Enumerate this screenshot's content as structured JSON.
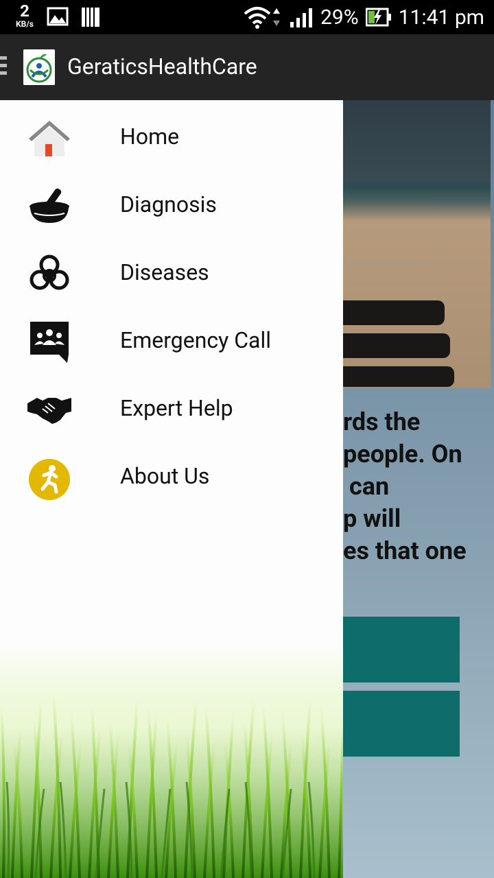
{
  "status_bar": {
    "net_speed_value": "2",
    "net_speed_unit": "KB/s",
    "battery_percent": "29%",
    "time": "11:41 pm"
  },
  "app_bar": {
    "title": "GeraticsHealthCare"
  },
  "drawer": {
    "items": [
      {
        "label": "Home",
        "icon": "home-icon"
      },
      {
        "label": "Diagnosis",
        "icon": "mortar-pestle-icon"
      },
      {
        "label": "Diseases",
        "icon": "biohazard-icon"
      },
      {
        "label": "Emergency Call",
        "icon": "group-chat-icon"
      },
      {
        "label": "Expert Help",
        "icon": "handshake-icon"
      },
      {
        "label": "About Us",
        "icon": "running-person-icon"
      }
    ]
  },
  "background_content": {
    "text_fragment": "rds the\npeople. On\n can\np will\nes that one"
  },
  "colors": {
    "app_bar": "#242424",
    "teal_button": "#0e6d6a",
    "about_icon": "#e3b800",
    "home_door": "#e34a2a"
  }
}
